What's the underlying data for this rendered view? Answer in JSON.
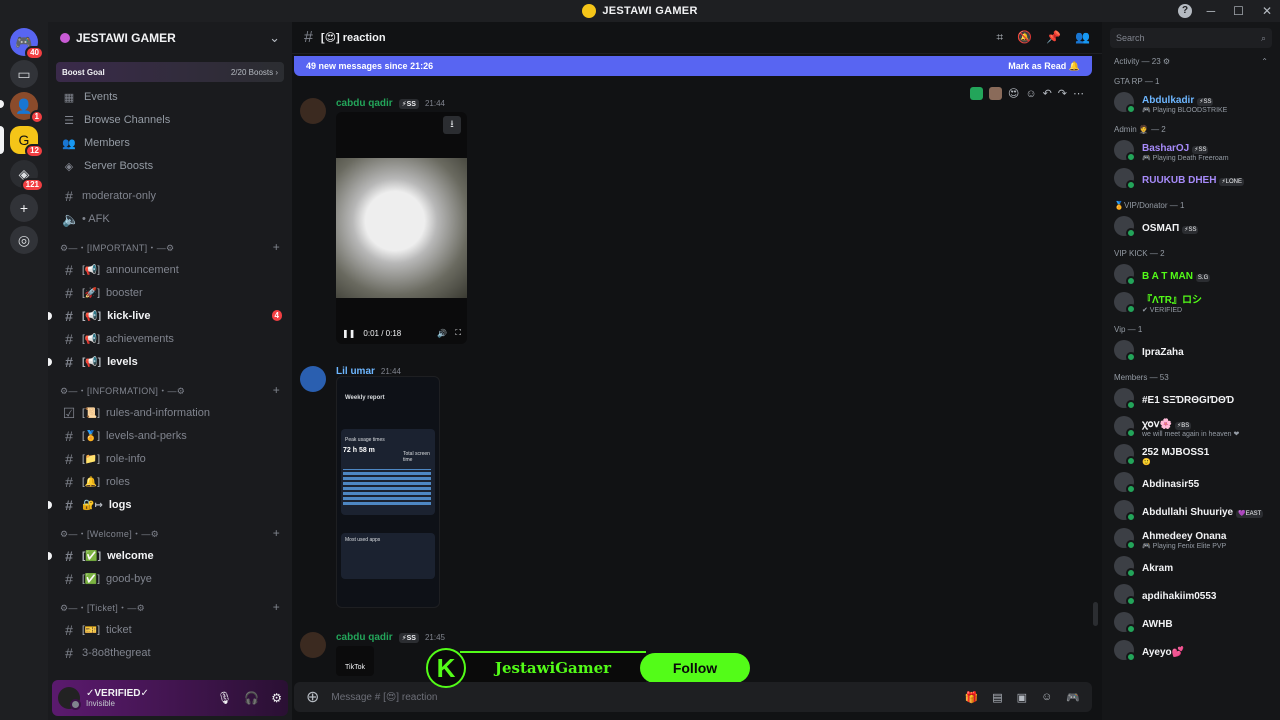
{
  "window": {
    "title": "JESTAWI GAMER"
  },
  "rail": {
    "badges": [
      "40",
      "1",
      "12",
      "121"
    ]
  },
  "server": {
    "name": "JESTAWI GAMER",
    "boost_label": "Boost Goal",
    "boost_count": "2/20 Boosts"
  },
  "nav": [
    {
      "label": "Events",
      "icon": "calendar-icon"
    },
    {
      "label": "Browse Channels",
      "icon": "browse-icon"
    },
    {
      "label": "Members",
      "icon": "members-icon"
    },
    {
      "label": "Server Boosts",
      "icon": "boost-icon"
    }
  ],
  "channels_top": [
    {
      "name": "moderator-only"
    },
    {
      "name": "• AFK"
    }
  ],
  "categories": [
    {
      "name": "⚙—・[IMPORTANT]・—⚙",
      "channels": [
        {
          "emoji": "[📢]",
          "name": "announcement",
          "unread": false
        },
        {
          "emoji": "[🚀]",
          "name": "booster",
          "unread": false
        },
        {
          "emoji": "[📢]",
          "name": "kick-live",
          "unread": true,
          "mention": "4"
        },
        {
          "emoji": "[📢]",
          "name": "achievements",
          "unread": false
        },
        {
          "emoji": "[📢]",
          "name": "levels",
          "unread": true
        }
      ]
    },
    {
      "name": "⚙—・[INFORMATION]・—⚙",
      "channels": [
        {
          "emoji": "[📜]",
          "name": "rules-and-information",
          "unread": false
        },
        {
          "emoji": "[🏅]",
          "name": "levels-and-perks",
          "unread": false
        },
        {
          "emoji": "[📁]",
          "name": "role-info",
          "unread": false
        },
        {
          "emoji": "[🔔]",
          "name": "roles",
          "unread": false
        },
        {
          "emoji": "🔐↦",
          "name": "logs",
          "unread": true
        }
      ]
    },
    {
      "name": "⚙—・[Welcome]・—⚙",
      "channels": [
        {
          "emoji": "[✅]",
          "name": "welcome",
          "unread": true
        },
        {
          "emoji": "[✅]",
          "name": "good-bye",
          "unread": false
        }
      ]
    },
    {
      "name": "⚙—・[Ticket]・—⚙",
      "channels": [
        {
          "emoji": "[🎫]",
          "name": "ticket",
          "unread": false
        },
        {
          "emoji": "",
          "name": "3-8o8thegreat",
          "unread": false
        }
      ]
    }
  ],
  "user": {
    "name": "✓VERIFIED✓",
    "status": "Invisible"
  },
  "chat": {
    "channel": "[😍] reaction",
    "new_messages": "49 new messages since 21:26",
    "mark_read": "Mark as Read",
    "composer_placeholder": "Message # [😍] reaction"
  },
  "messages": [
    {
      "author": "cabdu qadir",
      "tag": "⚡SS",
      "time": "21:44",
      "video_time": "0:01 / 0:18"
    },
    {
      "author": "Lil umar",
      "time": "21:44",
      "report_title": "Weekly report",
      "report_big": "72 h 58 m",
      "report_total": "Total screen time",
      "report_peak": "Peak usage times",
      "report_apps": "Most used apps"
    },
    {
      "author": "cabdu qadir",
      "tag": "⚡SS",
      "time": "21:45",
      "tiktok": "TikTok"
    }
  ],
  "overlay": {
    "name": "JestawiGamer",
    "follow": "Follow",
    "k": "K"
  },
  "members": {
    "search": "Search",
    "groups": [
      {
        "title": "Activity — 23 ⚙",
        "items": []
      },
      {
        "title": "GTA RP — 1",
        "items": [
          {
            "name": "Abdulkadir",
            "badge": "⚡SS",
            "activity": "🎮 Playing BLOODSTRIKE",
            "color": "#6db6ff"
          }
        ]
      },
      {
        "title": "Admin 🤵 — 2",
        "items": [
          {
            "name": "BasharOJ",
            "badge": "⚡SS",
            "activity": "🎮 Playing Death Freeroam",
            "color": "#a78bfa"
          },
          {
            "name": "RUUKUB DHEH",
            "badge": "⚡LONE",
            "activity": "",
            "color": "#a78bfa"
          }
        ]
      },
      {
        "title": "🏅VIP/Donator — 1",
        "items": [
          {
            "name": "OSMAΠ",
            "badge": "⚡SS",
            "activity": "",
            "color": "#f2f3f5"
          }
        ]
      },
      {
        "title": "VIP KICK — 2",
        "items": [
          {
            "name": "B A T MAN",
            "badge": "S.G",
            "activity": "",
            "color": "#53fc18"
          },
          {
            "name": "『ΛƬR』ロシ",
            "badge": "",
            "activity": "✔ VERIFIED",
            "color": "#53fc18"
          }
        ]
      },
      {
        "title": "Vip — 1",
        "items": [
          {
            "name": "IpraZaha",
            "badge": "",
            "activity": "",
            "color": "#f2f3f5"
          }
        ]
      },
      {
        "title": "Members — 53",
        "items": [
          {
            "name": "#E1 SΞƊRΘGIƊΘƊ",
            "badge": "",
            "activity": "",
            "color": "#f2f3f5"
          },
          {
            "name": "ꭓ𝗈𝗏🌸",
            "badge": "⚡BS",
            "activity": "we will meet again in heaven ❤",
            "color": "#f2f3f5"
          },
          {
            "name": "252 MJBOSS1",
            "badge": "",
            "activity": "🙂",
            "color": "#f2f3f5"
          },
          {
            "name": "Abdinasir55",
            "badge": "",
            "activity": "",
            "color": "#f2f3f5"
          },
          {
            "name": "Abdullahi Shuuriye",
            "badge": "💜EAST",
            "activity": "",
            "color": "#f2f3f5"
          },
          {
            "name": "Ahmedeey Onana",
            "badge": "",
            "activity": "🎮 Playing Fenix Elite PVP",
            "color": "#f2f3f5"
          },
          {
            "name": "Akram",
            "badge": "",
            "activity": "",
            "color": "#f2f3f5"
          },
          {
            "name": "apdihakiim0553",
            "badge": "",
            "activity": "",
            "color": "#f2f3f5"
          },
          {
            "name": "AWHB",
            "badge": "",
            "activity": "",
            "color": "#f2f3f5"
          },
          {
            "name": "Ayeyo💕",
            "badge": "",
            "activity": "",
            "color": "#f2f3f5"
          }
        ]
      }
    ]
  }
}
